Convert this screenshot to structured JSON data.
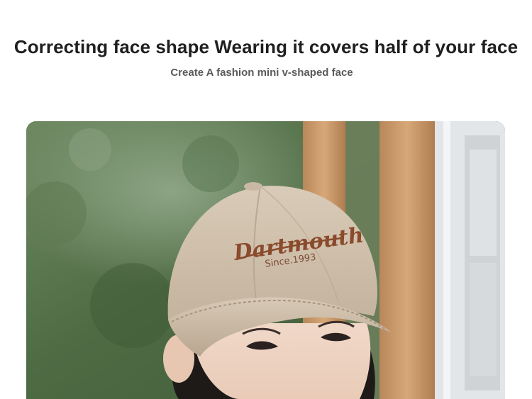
{
  "headline": "Correcting face shape Wearing it covers half of your face",
  "subheadline": "Create A fashion mini v-shaped face",
  "photo": {
    "cap_brand_text": "Dartmouth",
    "cap_since_text": "Since.1993",
    "colors": {
      "cap": "#cfc0ad",
      "embroidery": "#8a4a2c",
      "foliage": "#4f6b45",
      "wood": "#c99a68",
      "window": "#e6e8ea"
    }
  }
}
